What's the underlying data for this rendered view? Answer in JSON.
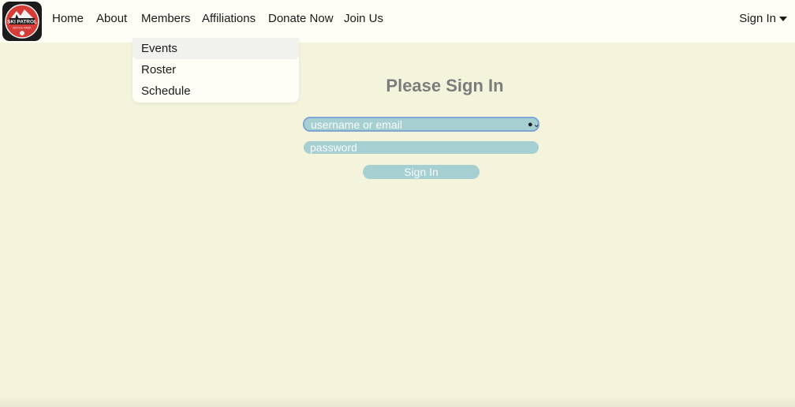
{
  "nav": {
    "logo": {
      "line1": "SKI PATROL",
      "line2": "BOYCE PARK"
    },
    "links": [
      "Home",
      "About",
      "Members",
      "Affiliations",
      "Donate Now",
      "Join Us"
    ],
    "sign_in_menu": "Sign In"
  },
  "members_dropdown": {
    "items": [
      "Events",
      "Roster",
      "Schedule"
    ],
    "highlighted": "Events"
  },
  "login": {
    "title": "Please Sign In",
    "username_placeholder": "username or email",
    "password_placeholder": "password",
    "submit_label": "Sign In"
  },
  "colors": {
    "page_bg": "#f4f4dc",
    "nav_bg": "#fefef6",
    "field_bg": "#a6cfd2",
    "title_text": "#7c7c7c"
  }
}
